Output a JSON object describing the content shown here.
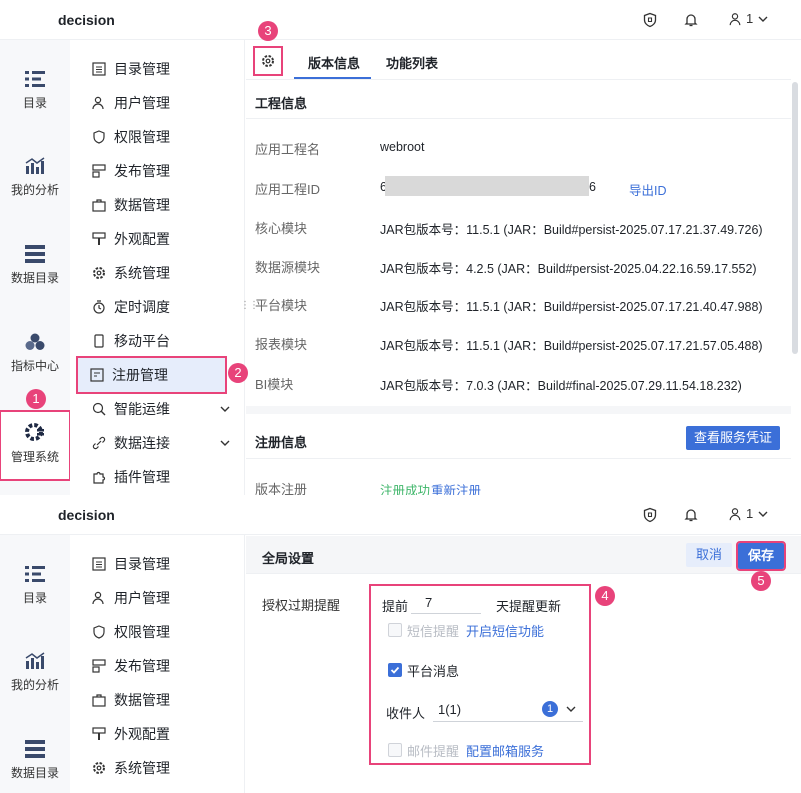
{
  "app": {
    "title": "decision",
    "user": "1"
  },
  "rail": [
    "目录",
    "我的分析",
    "数据目录",
    "指标中心",
    "管理系统"
  ],
  "menu": [
    "目录管理",
    "用户管理",
    "权限管理",
    "发布管理",
    "数据管理",
    "外观配置",
    "系统管理",
    "定时调度",
    "移动平台",
    "注册管理",
    "智能运维",
    "数据连接",
    "插件管理"
  ],
  "tabs": {
    "version": "版本信息",
    "functions": "功能列表"
  },
  "project": {
    "section_title": "工程信息",
    "rows": [
      {
        "label": "应用工程名",
        "value": "webroot"
      },
      {
        "label": "应用工程ID",
        "value_start": "6",
        "value_end": "6",
        "action": "导出ID"
      },
      {
        "label": "核心模块",
        "value": "JAR包版本号：11.5.1 (JAR：Build#persist-2025.07.17.21.37.49.726)"
      },
      {
        "label": "数据源模块",
        "value": "JAR包版本号：4.2.5 (JAR：Build#persist-2025.04.22.16.59.17.552)"
      },
      {
        "label": "平台模块",
        "value": "JAR包版本号：11.5.1 (JAR：Build#persist-2025.07.17.21.40.47.988)"
      },
      {
        "label": "报表模块",
        "value": "JAR包版本号：11.5.1 (JAR：Build#persist-2025.07.17.21.57.05.488)"
      },
      {
        "label": "BI模块",
        "value": "JAR包版本号：7.0.3 (JAR：Build#final-2025.07.29.11.54.18.232)"
      }
    ]
  },
  "register": {
    "section_title": "注册信息",
    "view_button": "查看服务凭证",
    "version_label": "版本注册",
    "status": "注册成功",
    "reregister": "重新注册"
  },
  "global": {
    "title": "全局设置",
    "cancel": "取消",
    "save": "保存",
    "expire_label": "授权过期提醒",
    "before": "提前",
    "days": "7",
    "after": "天提醒更新",
    "sms": "短信提醒",
    "sms_link": "开启短信功能",
    "platform_msg": "平台消息",
    "recipient_label": "收件人",
    "recipient_value": "1(1)",
    "recipient_count": "1",
    "email": "邮件提醒",
    "email_link": "配置邮箱服务"
  },
  "badges": [
    "1",
    "2",
    "3",
    "4",
    "5"
  ],
  "colors": {
    "accent": "#3b6fd8",
    "highlight": "#e8437a",
    "success": "#3fb66a"
  }
}
